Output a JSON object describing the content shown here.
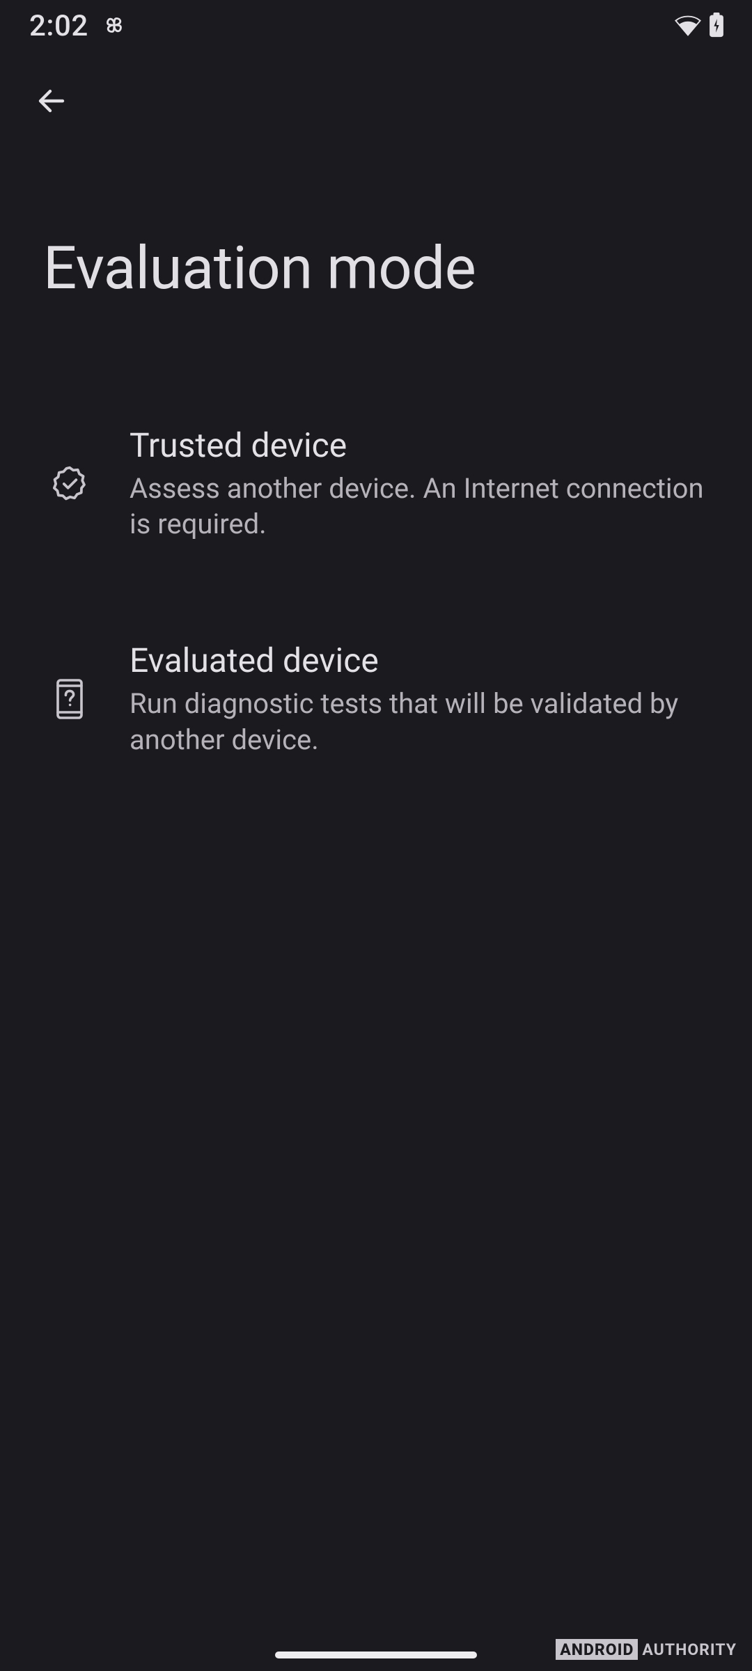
{
  "status": {
    "time": "2:02"
  },
  "header": {
    "title": "Evaluation mode"
  },
  "options": [
    {
      "title": "Trusted device",
      "description": "Assess another device. An Internet connection is required."
    },
    {
      "title": "Evaluated device",
      "description": "Run diagnostic tests that will be validated by another device."
    }
  ],
  "watermark": {
    "brand_a": "ANDROID",
    "brand_b": "AUTHORITY"
  }
}
